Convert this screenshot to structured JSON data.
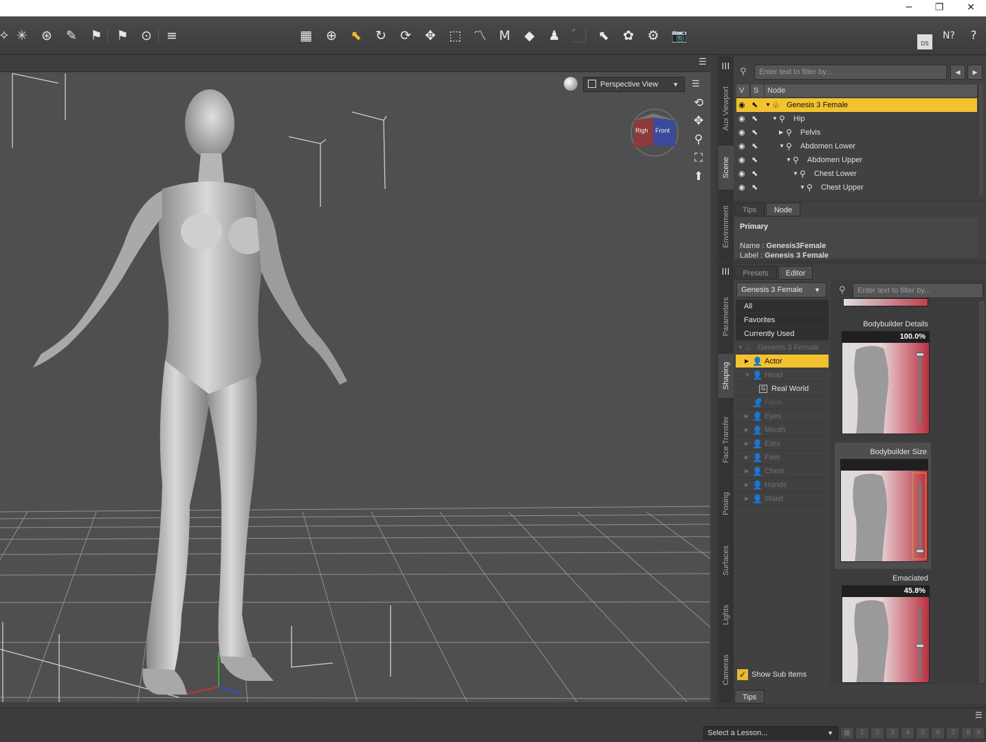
{
  "window": {
    "minimize": "─",
    "restore": "❐",
    "close": "✕"
  },
  "toolbar": {
    "tools": [
      "✧",
      "✳",
      "⊛",
      "✎",
      "⚑",
      "⊙",
      "≡",
      "▦",
      "⊕",
      "⬉",
      "↻",
      "⟳",
      "✥",
      "⬚",
      "〽",
      "Ⅿ",
      "◆",
      "♟",
      "⬛",
      "⬉",
      "✿",
      "⚙",
      "📷"
    ],
    "right": [
      "DS",
      "N?",
      "?"
    ]
  },
  "viewport": {
    "view_label": "Perspective View",
    "cube_left": "Righ",
    "cube_front": "Front"
  },
  "side_tabs_top": [
    "Aux Viewport",
    "Scene",
    "Environment"
  ],
  "side_tabs_bottom": [
    "Parameters",
    "Shaping",
    "Face Transfer",
    "Posing",
    "Surfaces",
    "Lights",
    "Cameras"
  ],
  "scene": {
    "filter_placeholder": "Enter text to filter by...",
    "columns": {
      "v": "V",
      "s": "S",
      "node": "Node"
    },
    "nodes": [
      {
        "label": "Genesis 3 Female",
        "depth": 0,
        "selected": true,
        "icon": "figure"
      },
      {
        "label": "Hip",
        "depth": 1
      },
      {
        "label": "Pelvis",
        "depth": 2
      },
      {
        "label": "Abdomen Lower",
        "depth": 2
      },
      {
        "label": "Abdomen Upper",
        "depth": 3
      },
      {
        "label": "Chest Lower",
        "depth": 4
      },
      {
        "label": "Chest Upper",
        "depth": 5
      }
    ]
  },
  "node_panel": {
    "tabs": [
      "Tips",
      "Node"
    ],
    "section": "Primary",
    "name_key": "Name : ",
    "name_value": "Genesis3Female",
    "label_key": "Label : ",
    "label_value": "Genesis 3 Female"
  },
  "shaping": {
    "tabs": [
      "Presets",
      "Editor"
    ],
    "figure_select": "Genesis 3 Female",
    "filter_placeholder": "Enter text to filter by...",
    "categories": [
      {
        "label": "All",
        "kind": "plain"
      },
      {
        "label": "Favorites",
        "kind": "plain"
      },
      {
        "label": "Currently Used",
        "kind": "plain"
      },
      {
        "label": "Genesis 3 Female",
        "kind": "dim-root"
      },
      {
        "label": "Actor",
        "kind": "sel"
      },
      {
        "label": "Head",
        "kind": "dim-open"
      },
      {
        "label": "Real World",
        "kind": "sub"
      },
      {
        "label": "Face",
        "kind": "dim-italic"
      },
      {
        "label": "Eyes",
        "kind": "dim"
      },
      {
        "label": "Mouth",
        "kind": "dim"
      },
      {
        "label": "Ears",
        "kind": "dim"
      },
      {
        "label": "Feet",
        "kind": "dim"
      },
      {
        "label": "Chest",
        "kind": "dim"
      },
      {
        "label": "Hands",
        "kind": "dim"
      },
      {
        "label": "Waist",
        "kind": "dim"
      }
    ],
    "show_sub_items": "Show Sub Items",
    "morphs": [
      {
        "title": "Bodybuilder Details",
        "value": "100.0%",
        "fraction": 1.0
      },
      {
        "title": "Bodybuilder Size",
        "value": "",
        "fraction": 0.0
      },
      {
        "title": "Emaciated",
        "value": "45.8%",
        "fraction": 0.458
      }
    ],
    "bottom_tab": "Tips"
  },
  "status": {
    "lesson_placeholder": "Select a Lesson...",
    "pages": [
      "1",
      "2",
      "3",
      "4",
      "5",
      "6",
      "7",
      "8",
      "9"
    ]
  }
}
